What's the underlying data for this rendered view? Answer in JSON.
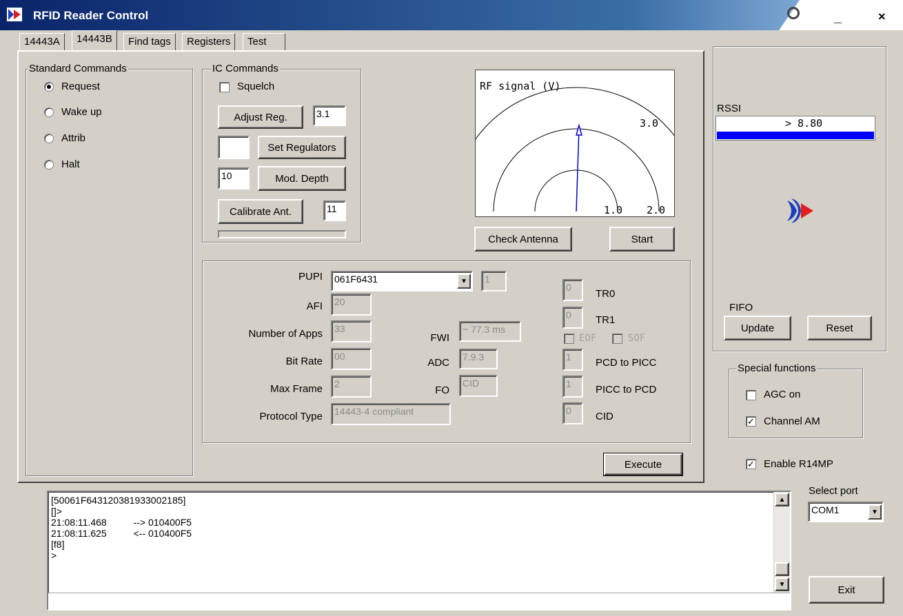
{
  "window": {
    "title": "RFID Reader Control"
  },
  "tabs": [
    "14443A",
    "14443B",
    "Find tags",
    "Registers",
    "Test"
  ],
  "standard_commands": {
    "title": "Standard Commands",
    "options": [
      "Request",
      "Wake up",
      "Attrib",
      "Halt"
    ],
    "selected": "Request"
  },
  "ic_commands": {
    "title": "IC Commands",
    "squelch_label": "Squelch",
    "squelch_checked": false,
    "adjust_reg_label": "Adjust Reg.",
    "adjust_reg_value": "3.1",
    "set_regulators_label": "Set Regulators",
    "set_regulators_value": "",
    "mod_depth_label": "Mod. Depth",
    "mod_depth_value": "10",
    "calibrate_label": "Calibrate Ant.",
    "calibrate_value": "11"
  },
  "rf_plot": {
    "title": "RF signal (V)",
    "ring_labels": [
      "1.0",
      "2.0",
      "3.0"
    ],
    "check_antenna_label": "Check Antenna",
    "start_label": "Start"
  },
  "params": {
    "pupi_label": "PUPI",
    "pupi_value": "061F6431",
    "pupi_index": "1",
    "afi_label": "AFI",
    "afi_value": "20",
    "apps_label": "Number of Apps",
    "apps_value": "33",
    "bitrate_label": "Bit Rate",
    "bitrate_value": "00",
    "maxframe_label": "Max Frame",
    "maxframe_value": "2",
    "protocol_label": "Protocol Type",
    "protocol_value": "14443-4 compliant",
    "fwi_label": "FWI",
    "fwi_value": "~ 77.3 ms",
    "adc_label": "ADC",
    "adc_value": "7.9.3",
    "fo_label": "FO",
    "fo_value": "CID",
    "tr0_label": "TR0",
    "tr0_value": "0",
    "tr1_label": "TR1",
    "tr1_value": "0",
    "eof_label": "EOF",
    "sof_label": "SOF",
    "pcd_picc_label": "PCD to PICC",
    "pcd_picc_value": "1",
    "picc_pcd_label": "PICC to PCD",
    "picc_pcd_value": "1",
    "cid_label": "CID",
    "cid_value": "0"
  },
  "execute_label": "Execute",
  "rssi": {
    "label": "RSSI",
    "value": "> 8.80",
    "fill_fraction": 1.0,
    "bar_color": "#0000ff"
  },
  "fifo": {
    "label": "FIFO",
    "update_label": "Update",
    "reset_label": "Reset"
  },
  "special": {
    "title": "Special functions",
    "agc_label": "AGC on",
    "agc_checked": false,
    "channel_am_label": "Channel AM",
    "channel_am_checked": true
  },
  "enable_r14mp_label": "Enable R14MP",
  "enable_r14mp_checked": true,
  "port": {
    "label": "Select port",
    "value": "COM1"
  },
  "exit_label": "Exit",
  "log": {
    "lines": [
      "[50061F643120381933002185]",
      "[]>",
      "21:08:11.468          --> 010400F5",
      "21:08:11.625          <-- 010400F5",
      "[f8]",
      ">"
    ]
  },
  "icons": {
    "app": "rfid-logo-icon",
    "help": "help-icon",
    "minimize": "minimize-icon",
    "close": "close-icon"
  },
  "colors": {
    "titlebar": "#0a246a",
    "face": "#d4d0c8",
    "rssi_bar": "#0000ff",
    "logo_red": "#e02020",
    "logo_blue": "#1a3fbf"
  }
}
